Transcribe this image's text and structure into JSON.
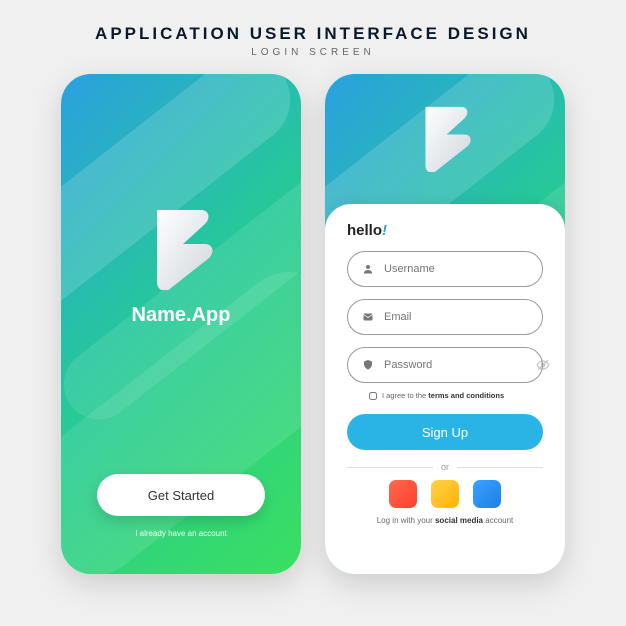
{
  "header": {
    "title": "APPLICATION USER INTERFACE DESIGN",
    "subtitle": "LOGIN SCREEN"
  },
  "splash": {
    "app_name": "Name.App",
    "get_started_label": "Get Started",
    "already_have_account": "I already have an account"
  },
  "login": {
    "greeting": "hello",
    "greeting_punct": "!",
    "username_placeholder": "Username",
    "email_placeholder": "Email",
    "password_placeholder": "Password",
    "terms_prefix": "I agree to the ",
    "terms_link": "terms and conditions",
    "signup_label": "Sign Up",
    "or_label": "or",
    "social_prefix": "Log in with your ",
    "social_bold": "social media",
    "social_suffix": " account"
  },
  "icons": {
    "user": "user-icon",
    "email": "email-icon",
    "shield": "shield-icon",
    "eye_off": "eye-off-icon",
    "logo": "app-logo"
  },
  "colors": {
    "gradient_a": "#2aa0e0",
    "gradient_b": "#3ae060",
    "accent": "#2ab4e6",
    "social_red": "#ff3e2e",
    "social_yellow": "#ffb300",
    "social_blue": "#1c7fe6"
  }
}
